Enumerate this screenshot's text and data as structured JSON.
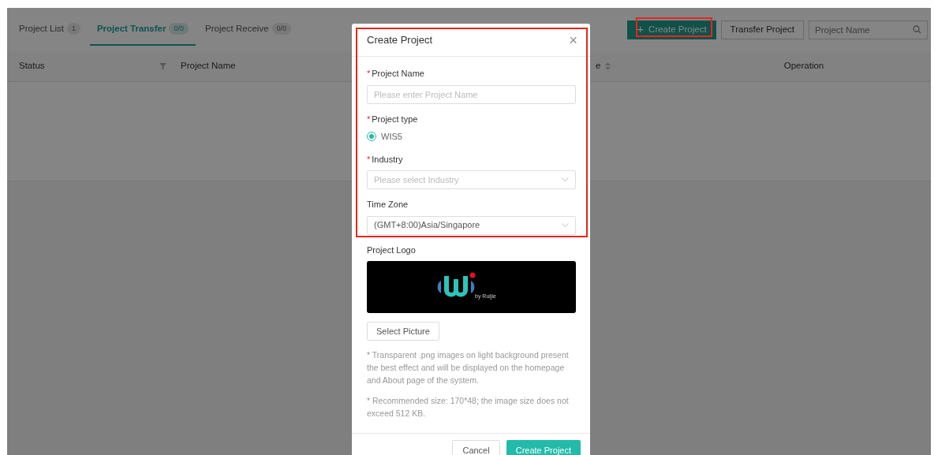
{
  "tabs": [
    {
      "label": "Project List",
      "count": "1",
      "selected": false
    },
    {
      "label": "Project Transfer",
      "count": "0/0",
      "selected": true
    },
    {
      "label": "Project Receive",
      "count": "0/0",
      "selected": false
    }
  ],
  "toolbar": {
    "create_button": "Create Project",
    "create_icon": "+",
    "transfer_button": "Transfer Project",
    "search": {
      "placeholder": "Project Name"
    }
  },
  "table": {
    "columns": [
      {
        "label": "Status",
        "kind": "filter"
      },
      {
        "label": "Project Name",
        "kind": "plain"
      },
      {
        "label": "e",
        "kind": "sort"
      },
      {
        "label": "Operation",
        "kind": "center"
      }
    ]
  },
  "dialog": {
    "title": "Create Project",
    "close": "×",
    "required_mark": "*",
    "fields": [
      {
        "kind": "input",
        "label": "Project Name",
        "required": true,
        "placeholder": "Please enter Project Name"
      },
      {
        "kind": "radio",
        "label": "Project type",
        "required": true,
        "options": [
          {
            "label": "WIS5",
            "selected": true
          }
        ]
      },
      {
        "kind": "select",
        "label": "Industry",
        "required": true,
        "placeholder": "Please select Industry"
      },
      {
        "kind": "select",
        "label": "Time Zone",
        "required": false,
        "value": "(GMT+8:00)Asia/Singapore"
      }
    ],
    "logo": {
      "label": "Project Logo",
      "caption": "by Ruijie"
    },
    "select_button": "Select Picture",
    "notes": [
      "* Transparent .png images on light background present the best effect and will be displayed on the homepage and About page of the system.",
      "* Recommended size: 170*48; the image size does not exceed 512 KB."
    ],
    "buttons": [
      {
        "label": "Cancel",
        "kind": "secondary"
      },
      {
        "label": "Create Project",
        "kind": "primary"
      }
    ]
  }
}
